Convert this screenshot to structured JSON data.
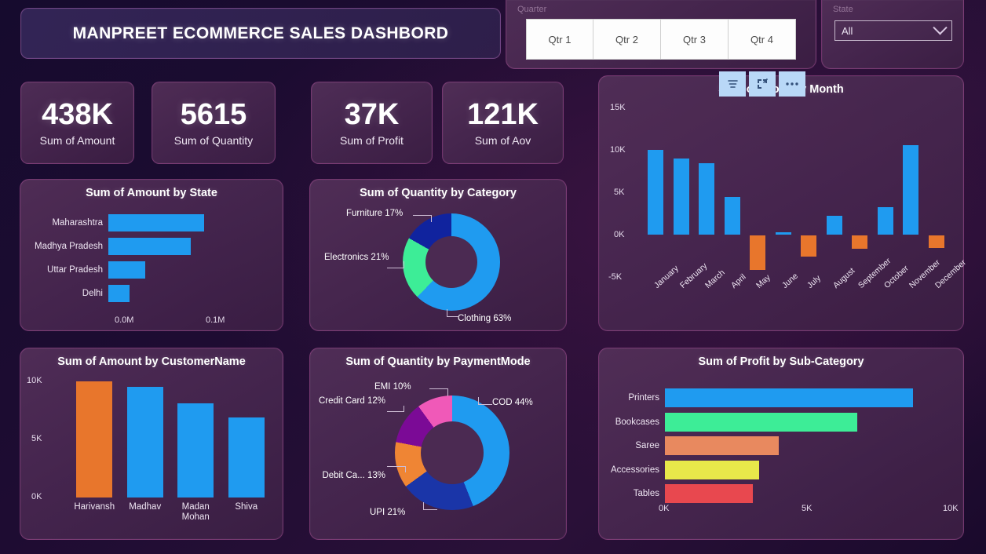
{
  "header": {
    "title": "MANPREET ECOMMERCE SALES DASHBORD"
  },
  "slicers": {
    "quarter": {
      "label": "Quarter",
      "options": [
        "Qtr 1",
        "Qtr 2",
        "Qtr 3",
        "Qtr 4"
      ]
    },
    "state": {
      "label": "State",
      "selected": "All",
      "chevron_icon": "chevron-down-icon"
    }
  },
  "kpis": [
    {
      "value": "438K",
      "caption": "Sum of Amount"
    },
    {
      "value": "5615",
      "caption": "Sum of Quantity"
    },
    {
      "value": "37K",
      "caption": "Sum of Profit"
    },
    {
      "value": "121K",
      "caption": "Sum of Aov"
    }
  ],
  "toolbar": {
    "filter_icon": "filter-icon",
    "focus_icon": "focus-mode-icon",
    "more_icon": "more-options-icon"
  },
  "colors": {
    "blue": "#1f9bf0",
    "orange": "#e8762c",
    "green": "#3ded97",
    "navy": "#10239e",
    "purple": "#7b0a96",
    "pink": "#f059b8",
    "salmon": "#e8895f",
    "yellow": "#e8e84a",
    "red": "#e8484f",
    "panel": "#4b2a52"
  },
  "chart_data": [
    {
      "id": "amount-by-state",
      "type": "bar",
      "orientation": "horizontal",
      "title": "Sum of Amount by State",
      "categories": [
        "Maharashtra",
        "Madhya Pradesh",
        "Uttar Pradesh",
        "Delhi"
      ],
      "values": [
        0.103,
        0.089,
        0.04,
        0.023
      ],
      "tick_labels": [
        "0.0M",
        "0.1M"
      ],
      "xlim": [
        0,
        0.1
      ],
      "xlabel": "",
      "ylabel": "",
      "grid": false,
      "series_color": "#1f9bf0"
    },
    {
      "id": "quantity-by-category",
      "type": "pie",
      "variant": "donut",
      "title": "Sum of Quantity by Category",
      "categories": [
        "Clothing",
        "Electronics",
        "Furniture"
      ],
      "values": [
        63,
        21,
        17
      ],
      "labels": [
        "Clothing 63%",
        "Electronics 21%",
        "Furniture 17%"
      ],
      "colors": [
        "#1f9bf0",
        "#3ded97",
        "#10239e"
      ],
      "legend": "labels-outside"
    },
    {
      "id": "profit-by-month",
      "type": "bar",
      "orientation": "vertical",
      "title": "Sum of Profit by Month",
      "categories": [
        "January",
        "February",
        "March",
        "April",
        "May",
        "June",
        "July",
        "August",
        "September",
        "October",
        "November",
        "December"
      ],
      "values": [
        9800,
        8800,
        8200,
        4400,
        -4000,
        300,
        -2500,
        2200,
        -1600,
        3200,
        10300,
        -1500
      ],
      "tick_labels": [
        "15K",
        "10K",
        "5K",
        "0K",
        "-5K"
      ],
      "ylim": [
        -5000,
        15000
      ],
      "xlabel": "",
      "ylabel": "",
      "grid": false,
      "positive_color": "#1f9bf0",
      "negative_color": "#e8762c"
    },
    {
      "id": "amount-by-customername",
      "type": "bar",
      "orientation": "vertical",
      "title": "Sum of Amount by CustomerName",
      "categories": [
        "Harivansh",
        "Madhav",
        "Madan Mohan",
        "Shiva"
      ],
      "values": [
        9900,
        9400,
        8000,
        6800
      ],
      "tick_labels": [
        "10K",
        "5K",
        "0K"
      ],
      "ylim": [
        0,
        10000
      ],
      "xlabel": "",
      "ylabel": "",
      "grid": false,
      "bar_colors": [
        "#e8762c",
        "#1f9bf0",
        "#1f9bf0",
        "#1f9bf0"
      ]
    },
    {
      "id": "quantity-by-paymentmode",
      "type": "pie",
      "variant": "donut",
      "title": "Sum of Quantity by PaymentMode",
      "categories": [
        "COD",
        "UPI",
        "Debit Ca...",
        "Credit Card",
        "EMI"
      ],
      "values": [
        44,
        21,
        13,
        12,
        10
      ],
      "labels": [
        "COD 44%",
        "UPI 21%",
        "Debit Ca... 13%",
        "Credit Card 12%",
        "EMI 10%"
      ],
      "colors": [
        "#1f9bf0",
        "#1a35a8",
        "#ef8534",
        "#7b0a96",
        "#f059b8"
      ],
      "legend": "labels-outside"
    },
    {
      "id": "profit-by-subcategory",
      "type": "bar",
      "orientation": "horizontal",
      "title": "Sum of Profit by Sub-Category",
      "categories": [
        "Printers",
        "Bookcases",
        "Saree",
        "Accessories",
        "Tables"
      ],
      "values": [
        8600,
        6650,
        3950,
        3250,
        3050
      ],
      "tick_labels": [
        "0K",
        "5K",
        "10K"
      ],
      "xlim": [
        0,
        10000
      ],
      "xlabel": "",
      "ylabel": "",
      "grid": false,
      "bar_colors": [
        "#1f9bf0",
        "#3ded97",
        "#e8895f",
        "#e8e84a",
        "#e8484f"
      ]
    }
  ]
}
